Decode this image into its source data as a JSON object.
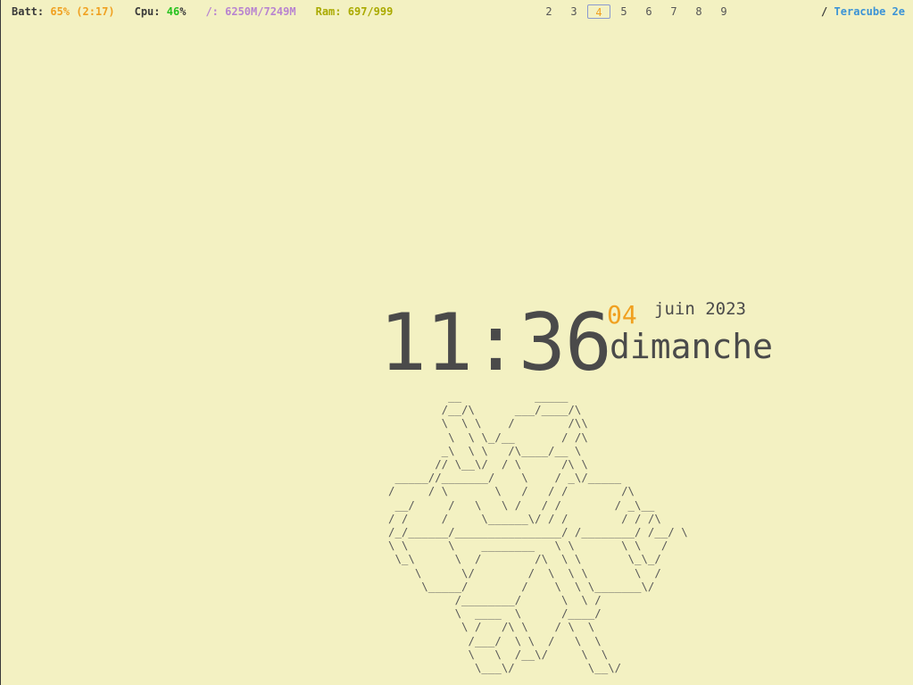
{
  "bar": {
    "batt_label": "Batt:",
    "batt_value": "65% (2:17)",
    "cpu_label": "Cpu:",
    "cpu_value": "46",
    "cpu_unit": "%",
    "disk_label": "/:",
    "disk_value": "6250M/7249M",
    "ram_label": "Ram:",
    "ram_value": "697/999",
    "workspaces": [
      "2",
      "3",
      "4",
      "5",
      "6",
      "7",
      "8",
      "9"
    ],
    "active_workspace": "4",
    "title_prefix": "/",
    "title": "Teracube 2e"
  },
  "clock": {
    "time": "11:36",
    "day": "04",
    "month_year": "juin 2023",
    "weekday": "dimanche"
  },
  "ascii_art": "         __           _____\n        /__/\\      ___/____/\\\n        \\  \\ \\    /        /\\\\\n         \\  \\ \\_/__       / /\\\n        _\\  \\ \\   /\\____/__ \\\n       // \\__\\/  / \\      /\\ \\\n _____//_______/    \\    / _\\/_____\n/     / \\       \\   /   / /        /\\\n __/     /   \\   \\ /   / /        / _\\__\n/ /     /     \\______\\/ / /        / / /\\\n/_/______/________________/ /________/ /__/ \\\n\\ \\      \\    ________   \\ \\       \\ \\   /\n \\_\\      \\  /        /\\  \\ \\       \\_\\_/\n    \\      \\/        /  \\  \\ \\       \\  /\n     \\_____/        /    \\  \\ \\_______\\/\n          /________/      \\  \\ /\n          \\  ____  \\      /____/\n           \\ /   /\\ \\    / \\  \\\n            /___/  \\ \\  /   \\  \\\n            \\   \\  /__\\/     \\  \\\n             \\___\\/           \\__\\/",
  "colors": {
    "background": "#f3f1c2",
    "accent_orange": "#f0a020",
    "cpu_green": "#27c21f",
    "disk_purple": "#b884d0",
    "ram_olive": "#aaaa00",
    "title_blue": "#3b93d6",
    "text": "#4a4a4a"
  }
}
